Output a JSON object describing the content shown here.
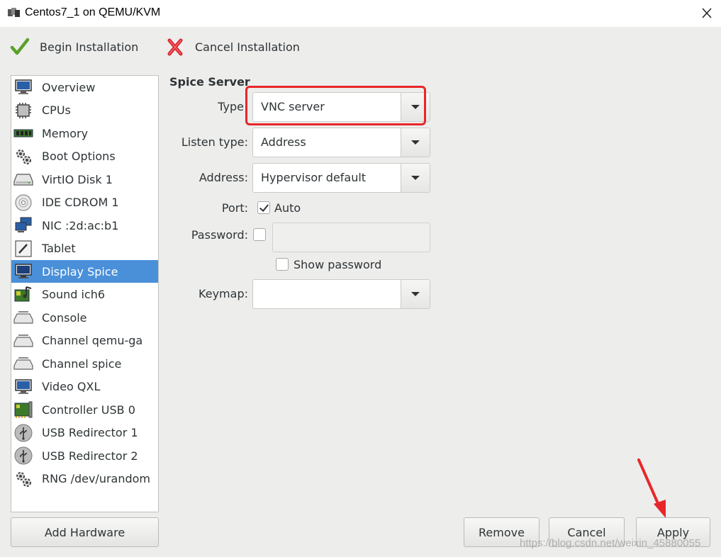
{
  "window": {
    "title": "Centos7_1 on QEMU/KVM"
  },
  "toolbar": {
    "begin_label": "Begin Installation",
    "cancel_label": "Cancel Installation"
  },
  "sidebar": {
    "items": [
      {
        "label": "Overview",
        "icon": "monitor-icon"
      },
      {
        "label": "CPUs",
        "icon": "cpu-icon"
      },
      {
        "label": "Memory",
        "icon": "memory-icon"
      },
      {
        "label": "Boot Options",
        "icon": "gears-icon"
      },
      {
        "label": "VirtIO Disk 1",
        "icon": "disk-icon"
      },
      {
        "label": "IDE CDROM 1",
        "icon": "cdrom-icon"
      },
      {
        "label": "NIC :2d:ac:b1",
        "icon": "network-icon"
      },
      {
        "label": "Tablet",
        "icon": "tablet-icon"
      },
      {
        "label": "Display Spice",
        "icon": "display-icon",
        "selected": true
      },
      {
        "label": "Sound ich6",
        "icon": "sound-card-icon"
      },
      {
        "label": "Console",
        "icon": "serial-icon"
      },
      {
        "label": "Channel qemu-ga",
        "icon": "serial-icon"
      },
      {
        "label": "Channel spice",
        "icon": "serial-icon"
      },
      {
        "label": "Video QXL",
        "icon": "monitor-icon"
      },
      {
        "label": "Controller USB 0",
        "icon": "controller-card-icon"
      },
      {
        "label": "USB Redirector 1",
        "icon": "usb-icon"
      },
      {
        "label": "USB Redirector 2",
        "icon": "usb-icon"
      },
      {
        "label": "RNG /dev/urandom",
        "icon": "gears-icon"
      }
    ],
    "add_hardware_label": "Add Hardware"
  },
  "form": {
    "section_title": "Spice Server",
    "type_label": "Type",
    "type_value": "VNC server",
    "listen_label": "Listen type:",
    "listen_value": "Address",
    "address_label": "Address:",
    "address_value": "Hypervisor default",
    "port_label": "Port:",
    "port_auto_label": "Auto",
    "port_auto_checked": true,
    "password_label": "Password:",
    "password_checked": false,
    "password_value": "",
    "show_password_label": "Show password",
    "show_password_checked": false,
    "keymap_label": "Keymap:",
    "keymap_value": ""
  },
  "buttons": {
    "remove": "Remove",
    "cancel": "Cancel",
    "apply": "Apply"
  },
  "watermark": "https://blog.csdn.net/weixin_45880055",
  "colors": {
    "selection": "#4a90d9",
    "highlight_box": "#e8262a",
    "annotation_arrow": "#e8262a"
  }
}
